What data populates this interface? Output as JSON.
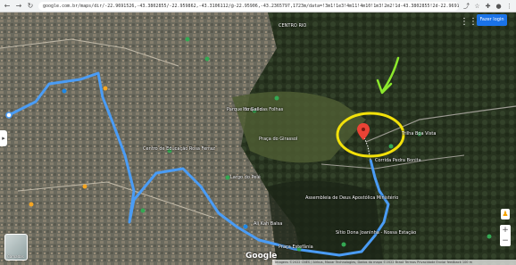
{
  "browser": {
    "back": "←",
    "forward": "→",
    "reload": "↻",
    "url": "google.com.br/maps/dir/-22.9691526,-43.3802855/-22.959862,-43.3106112/@-22.95906,-43.2365797,1723m/data=!3m1!1e3!4m11!4m10!1m3!2m2!1d-43.3802855!2d-22.9691526!1m5!1m1!1s0x997b8a39c1...",
    "icons": [
      "share-icon",
      "star-icon",
      "extension-icon",
      "profile-icon",
      "menu-icon"
    ]
  },
  "map": {
    "apps_icon": "⋮⋮",
    "login_label": "Fazer login",
    "layers_label": "Camadas",
    "zoom_in": "+",
    "zoom_out": "−",
    "pegman": "♟",
    "google_logo": "Google",
    "attribution": "Imagens ©2022 CNES / Airbus, Maxar Technologies, Dados do mapa ©2022   Brasil   Termos   Privacidade   Enviar feedback   100 m",
    "places": [
      {
        "name": "Parque das Folhas"
      },
      {
        "name": "Parque do Gallo"
      },
      {
        "name": "Praça do Girassol"
      },
      {
        "name": "Trilha Boa Vista"
      },
      {
        "name": "Centro de Educação Rosa Ferraz"
      },
      {
        "name": "Corrida Pedra Bonita"
      },
      {
        "name": "Largo do Pelé"
      },
      {
        "name": "Assembleia de Deus Apostólica Ministério"
      },
      {
        "name": "Sítio Dona Joaninha - Nossa Estação"
      },
      {
        "name": "Ali Kah Balsa"
      },
      {
        "name": "Praça Estefânia"
      },
      {
        "name": "CENTRO RIO"
      }
    ]
  },
  "colors": {
    "route": "#4a9cf5",
    "highlight": "#f2e10a",
    "arrow": "#8ce82c",
    "pin": "#ea4335"
  }
}
